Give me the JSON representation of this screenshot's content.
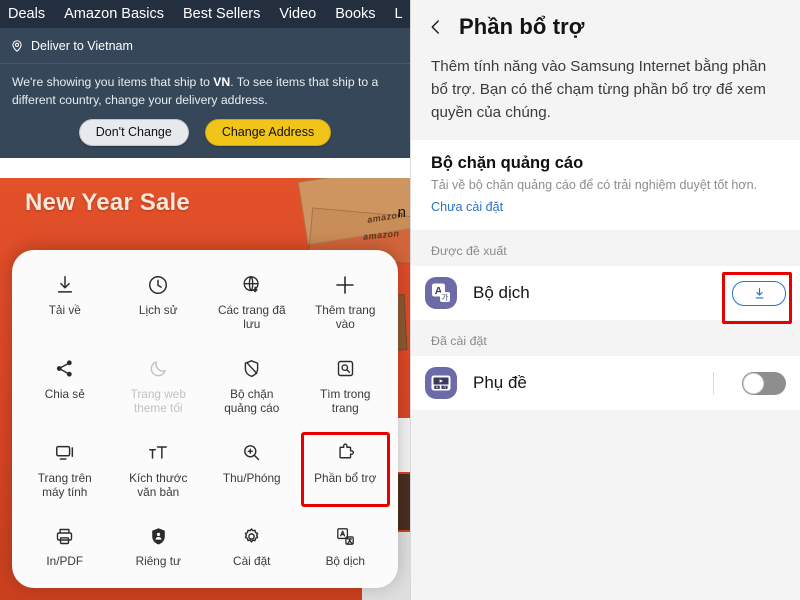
{
  "left": {
    "amazon_nav": {
      "items": [
        "Deals",
        "Amazon Basics",
        "Best Sellers",
        "Video",
        "Books",
        "L"
      ]
    },
    "deliver_bar": {
      "label": "Deliver to Vietnam",
      "icon": "location-pin-icon"
    },
    "notice": {
      "text_before": "We're showing you items that ship to ",
      "country": "VN",
      "text_after": ". To see items that ship to a different country, change your delivery address.",
      "buttons": {
        "dont_change": "Don't Change",
        "change_address": "Change Address"
      }
    },
    "hero": {
      "title": "New Year Sale",
      "brand_word": "amazon"
    },
    "menu_sheet": {
      "items": [
        {
          "label": "Tải về",
          "icon": "download-icon",
          "disabled": false,
          "highlighted": false
        },
        {
          "label": "Lịch sử",
          "icon": "clock-history-icon",
          "disabled": false,
          "highlighted": false
        },
        {
          "label": "Các trang đã lưu",
          "icon": "globe-saved-pages-icon",
          "disabled": false,
          "highlighted": false
        },
        {
          "label": "Thêm trang vào",
          "icon": "plus-icon",
          "disabled": false,
          "highlighted": false
        },
        {
          "label": "Chia sẻ",
          "icon": "share-icon",
          "disabled": false,
          "highlighted": false
        },
        {
          "label": "Trang web theme tối",
          "icon": "moon-dark-mode-icon",
          "disabled": true,
          "highlighted": false
        },
        {
          "label": "Bộ chặn quảng cáo",
          "icon": "shield-block-icon",
          "disabled": false,
          "highlighted": false
        },
        {
          "label": "Tìm trong trang",
          "icon": "find-in-page-icon",
          "disabled": false,
          "highlighted": false
        },
        {
          "label": "Trang trên máy tính",
          "icon": "desktop-monitor-icon",
          "disabled": false,
          "highlighted": false
        },
        {
          "label": "Kích thước văn bản",
          "icon": "text-size-icon",
          "disabled": false,
          "highlighted": false
        },
        {
          "label": "Thu/Phóng",
          "icon": "zoom-in-icon",
          "disabled": false,
          "highlighted": false
        },
        {
          "label": "Phần bổ trợ",
          "icon": "puzzle-extension-icon",
          "disabled": false,
          "highlighted": true
        },
        {
          "label": "In/PDF",
          "icon": "printer-icon",
          "disabled": false,
          "highlighted": false
        },
        {
          "label": "Riêng tư",
          "icon": "privacy-shield-person-icon",
          "disabled": false,
          "highlighted": false
        },
        {
          "label": "Cài đặt",
          "icon": "gear-settings-icon",
          "disabled": false,
          "highlighted": false
        },
        {
          "label": "Bộ dịch",
          "icon": "translate-icon",
          "disabled": false,
          "highlighted": false
        }
      ]
    }
  },
  "right": {
    "header": {
      "back_icon": "chevron-left-icon",
      "title": "Phần bổ trợ"
    },
    "description": "Thêm tính năng vào Samsung Internet bằng phần bổ trợ. Bạn có thể chạm từng phần bổ trợ để xem quyền của chúng.",
    "adblock_card": {
      "title": "Bộ chặn quảng cáo",
      "subtitle": "Tải về bộ chặn quảng cáo để có trải nghiệm duyệt tốt hơn.",
      "status_link": "Chưa cài đặt",
      "link_color": "#2a72c8"
    },
    "suggested": {
      "section_label": "Được đề xuất",
      "items": [
        {
          "label": "Bộ dịch",
          "icon": "translator-app-icon",
          "action_icon": "download-icon",
          "action_type": "download-button",
          "highlighted": true
        }
      ]
    },
    "installed": {
      "section_label": "Đã cài đặt",
      "items": [
        {
          "label": "Phụ đề",
          "icon": "subtitles-app-icon",
          "action_type": "toggle",
          "toggle_on": false,
          "highlighted": false
        }
      ]
    }
  },
  "colors": {
    "highlight_red": "#e60000",
    "amazon_nav_bg": "#232f3e",
    "amazon_bar_bg": "#37475a",
    "amazon_gold": "#f0c419",
    "hero_orange": "#dc4726",
    "samsung_blue": "#2a72c8",
    "app_icon_purple": "#6c6ba8"
  }
}
